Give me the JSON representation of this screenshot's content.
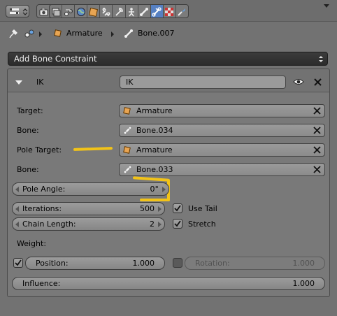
{
  "header": {
    "context_icons": [
      "render-icon",
      "render-layers-icon",
      "scene-icon",
      "world-icon",
      "object-icon",
      "constraints-icon",
      "modifiers-icon",
      "object-data-icon",
      "bone-icon",
      "bone-constraints-icon",
      "material-icon",
      "texture-icon"
    ]
  },
  "breadcrumb": {
    "object": "Armature",
    "bone": "Bone.007"
  },
  "add_constraint_label": "Add Bone Constraint",
  "constraint": {
    "type_label": "IK",
    "name": "IK",
    "target_label": "Target:",
    "target_value": "Armature",
    "bone_label": "Bone:",
    "bone_value": "Bone.034",
    "pole_target_label": "Pole Target:",
    "pole_target_value": "Armature",
    "pole_bone_label": "Bone:",
    "pole_bone_value": "Bone.033",
    "pole_angle_label": "Pole Angle:",
    "pole_angle_value": "0°",
    "iterations_label": "Iterations:",
    "iterations_value": "500",
    "chain_length_label": "Chain Length:",
    "chain_length_value": "2",
    "use_tail_label": "Use Tail",
    "use_tail_checked": true,
    "stretch_label": "Stretch",
    "stretch_checked": true,
    "weight_label": "Weight:",
    "position_label": "Position:",
    "position_value": "1.000",
    "position_checked": true,
    "rotation_label": "Rotation:",
    "rotation_value": "1.000",
    "rotation_checked": false,
    "influence_label": "Influence:",
    "influence_value": "1.000"
  },
  "colors": {
    "active_tab": "#5680c2",
    "annotation": "#f2c318",
    "object_orange": "#e8a553"
  }
}
